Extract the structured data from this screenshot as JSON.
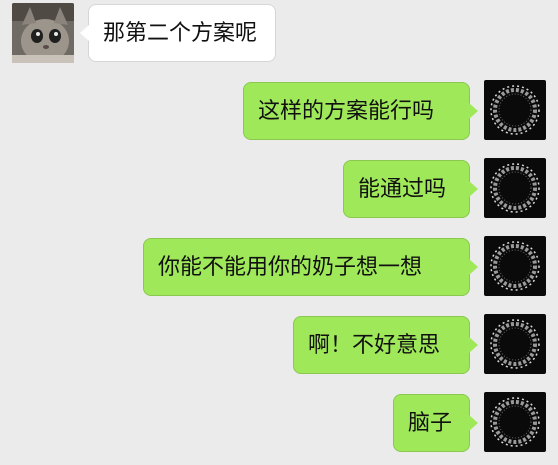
{
  "messages": [
    {
      "direction": "incoming",
      "text": "那第二个方案呢",
      "avatar": "cat-photo-avatar"
    },
    {
      "direction": "outgoing",
      "text": "这样的方案能行吗",
      "avatar": "dark-wreath-avatar"
    },
    {
      "direction": "outgoing",
      "text": "能通过吗",
      "avatar": "dark-wreath-avatar"
    },
    {
      "direction": "outgoing",
      "text": "你能不能用你的奶子想一想",
      "avatar": "dark-wreath-avatar"
    },
    {
      "direction": "outgoing",
      "text": "啊！不好意思",
      "avatar": "dark-wreath-avatar"
    },
    {
      "direction": "outgoing",
      "text": "脑子",
      "avatar": "dark-wreath-avatar"
    }
  ],
  "colors": {
    "background": "#ebebeb",
    "incoming_bubble": "#ffffff",
    "outgoing_bubble": "#9fe85a"
  }
}
